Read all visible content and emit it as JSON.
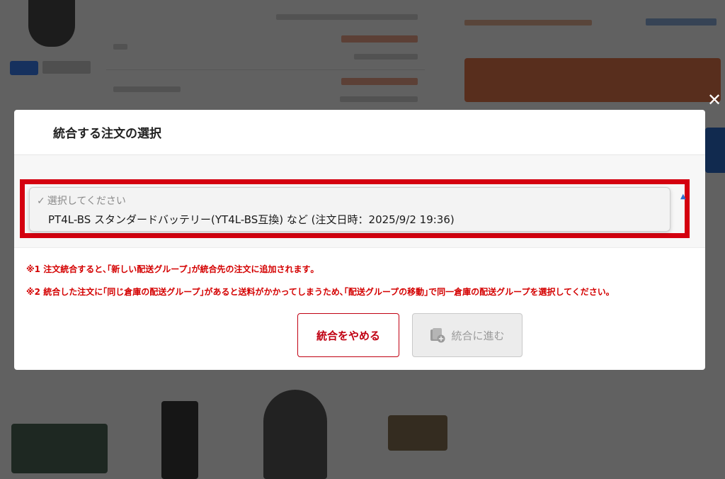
{
  "modal": {
    "title": "統合する注文の選択",
    "close_icon": "close-icon",
    "select": {
      "placeholder_check": "✓",
      "placeholder": "選択してください",
      "options": [
        "PT4L-BS スタンダードバッテリー(YT4L-BS互換) など (注文日時：2025/9/2 19:36)"
      ]
    },
    "notes": [
      "※1 注文統合すると､｢新しい配送グループ｣が統合先の注文に追加されます｡",
      "※2 統合した注文に｢同じ倉庫の配送グループ｣があると送料がかかってしまうため､｢配送グループの移動｣で同一倉庫の配送グループを選択してください｡"
    ],
    "buttons": {
      "cancel_label": "統合をやめる",
      "proceed_label": "統合に進む",
      "proceed_icon": "merge-add-icon"
    }
  },
  "colors": {
    "highlight_border": "#d4000f",
    "note_text": "#d40000",
    "cancel_accent": "#c00012",
    "overlay": "rgba(0,0,0,0.62)"
  }
}
